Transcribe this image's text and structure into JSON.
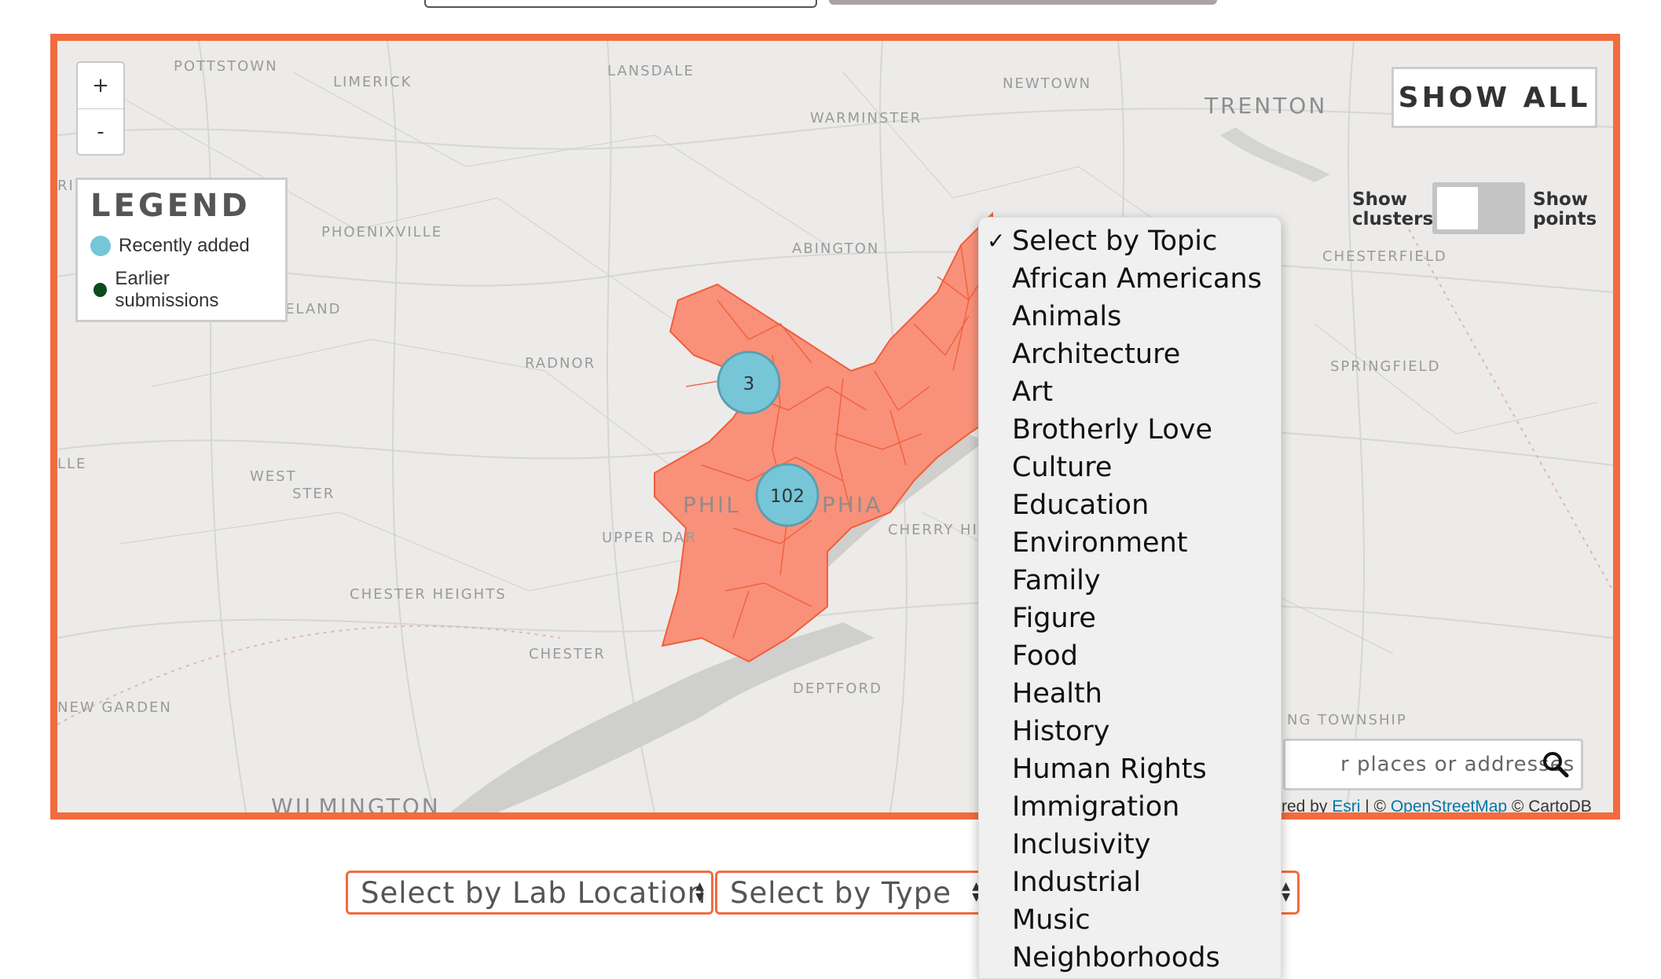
{
  "map": {
    "zoom_in": "+",
    "zoom_out": "-",
    "place_labels": [
      "POTTSTOWN",
      "LIMERICK",
      "LANSDALE",
      "NEWTOWN",
      "TRENTON",
      "WARMINSTER",
      "PHOENIXVILLE",
      "ABINGTON",
      "CHESTERFIELD",
      "RADNOR",
      "SPRINGFIELD",
      "WEST",
      "STER",
      "PHIL",
      "PHIA",
      "CHERRY HIL",
      "UPPER DAR",
      "CHESTER HEIGHTS",
      "CHESTER",
      "DEPTFORD",
      "NEW GARDEN",
      "WILMINGTON",
      "NG TOWNSHIP",
      "ELAND",
      "LLE",
      "RI"
    ],
    "clusters": [
      {
        "label": "3"
      },
      {
        "label": "102"
      }
    ],
    "region_fill": "#f9917a",
    "cluster_color": "#76c6d8",
    "frame_color": "#f26c3f"
  },
  "legend": {
    "title": "LEGEND",
    "items": [
      {
        "label": "Recently added",
        "color": "#76c6d8"
      },
      {
        "label": "Earlier submissions",
        "color": "#0e4a1c"
      }
    ]
  },
  "show_all": {
    "label": "SHOW ALL"
  },
  "toggle": {
    "left_label_1": "Show",
    "left_label_2": "clusters",
    "right_label_1": "Show",
    "right_label_2": "points"
  },
  "search": {
    "placeholder": "r places or addresses",
    "icon": "search-icon"
  },
  "attribution": {
    "prefix": "red by ",
    "esri": "Esri",
    "sep": " | © ",
    "osm": "OpenStreetMap",
    "carto": " © CartoDB"
  },
  "filters": {
    "lab_location": "Select by Lab Location",
    "type": "Select by Type"
  },
  "topic_dropdown": {
    "selected": "Select by Topic",
    "options": [
      "Select by Topic",
      "African Americans",
      "Animals",
      "Architecture",
      "Art",
      "Brotherly Love",
      "Culture",
      "Education",
      "Environment",
      "Family",
      "Figure",
      "Food",
      "Health",
      "History",
      "Human Rights",
      "Immigration",
      "Inclusivity",
      "Industrial",
      "Music",
      "Neighborhoods"
    ]
  }
}
